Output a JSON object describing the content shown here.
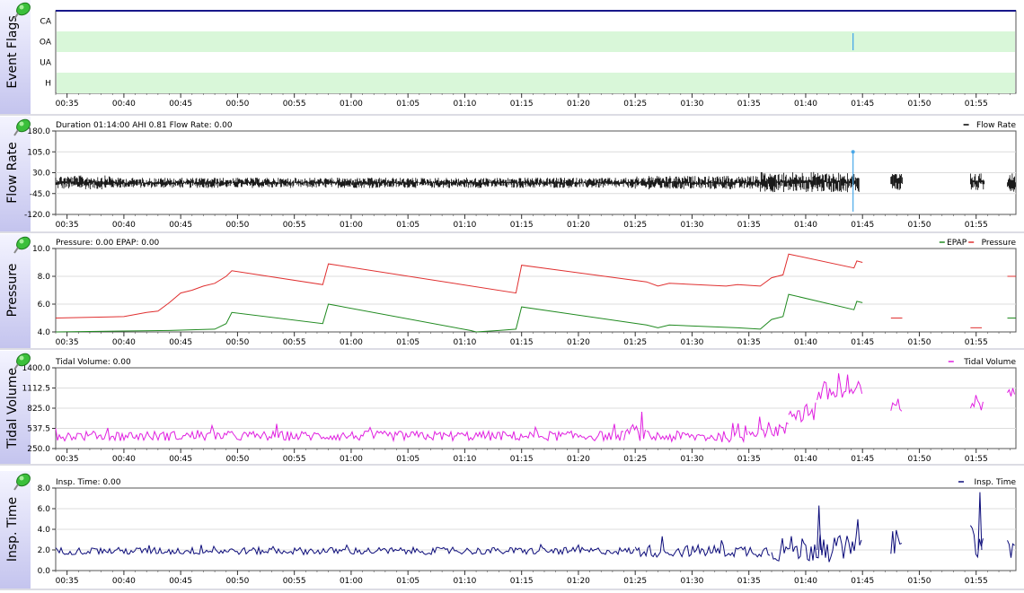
{
  "time_ticks": [
    "00:35",
    "00:40",
    "00:45",
    "00:50",
    "00:55",
    "01:00",
    "01:05",
    "01:10",
    "01:15",
    "01:20",
    "01:25",
    "01:30",
    "01:35",
    "01:40",
    "01:45",
    "01:50",
    "01:55"
  ],
  "colors": {
    "side_gradient_top": "#f4f4ff",
    "side_gradient_bottom": "#c4c4ee",
    "event_band": "#d9f7d9",
    "flow": "#000000",
    "marker": "#4aa8e8",
    "pressure": "#e03030",
    "epap": "#208a20",
    "tidal": "#e020e0",
    "insp": "#0c0c7a",
    "frame_top": "#18188a",
    "grid": "#dcdcdc"
  },
  "icons": {
    "pin": "green-pushpin-icon"
  },
  "chart_data": [
    {
      "type": "event-flags",
      "ylabel": "Event Flags",
      "categories": [
        "CA",
        "OA",
        "UA",
        "H"
      ],
      "shaded_rows": [
        "OA",
        "H"
      ],
      "events": [
        {
          "flag": "OA",
          "time": "01:44:10"
        }
      ]
    },
    {
      "type": "line",
      "ylabel": "Flow Rate",
      "info": "Duration 01:14:00 AHI 0.81 Flow Rate: 0.00",
      "legend": [
        "Flow Rate"
      ],
      "yticks": [
        "180.0",
        "105.0",
        "30.0",
        "-45.0",
        "-120.0"
      ],
      "ylim": [
        -120,
        180
      ],
      "series": [
        {
          "name": "Flow Rate",
          "color": "#000000",
          "envelope": [
            {
              "t0": "00:34:00",
              "t1": "00:39:00",
              "lo": -30,
              "hi": 20
            },
            {
              "t0": "00:39:00",
              "t1": "01:25:00",
              "lo": -25,
              "hi": 12
            },
            {
              "t0": "01:25:00",
              "t1": "01:36:00",
              "lo": -30,
              "hi": 18
            },
            {
              "t0": "01:36:00",
              "t1": "01:44:45",
              "lo": -40,
              "hi": 33
            },
            {
              "t0": "01:47:30",
              "t1": "01:48:30",
              "lo": -35,
              "hi": 28
            },
            {
              "t0": "01:54:30",
              "t1": "01:55:45",
              "lo": -35,
              "hi": 28
            },
            {
              "t0": "01:57:45",
              "t1": "01:58:30",
              "lo": -40,
              "hi": 30
            }
          ]
        }
      ],
      "marker": {
        "time": "01:44:10",
        "value": 105
      }
    },
    {
      "type": "line",
      "ylabel": "Pressure",
      "info": "Pressure: 0.00 EPAP: 0.00",
      "legend": [
        "EPAP",
        "Pressure"
      ],
      "yticks": [
        "10.0",
        "8.0",
        "6.0",
        "4.0"
      ],
      "ylim": [
        4,
        10
      ],
      "series": [
        {
          "name": "Pressure",
          "color": "#e03030",
          "points": [
            [
              "00:34:00",
              5.0
            ],
            [
              "00:40:00",
              5.1
            ],
            [
              "00:42:00",
              5.4
            ],
            [
              "00:43:00",
              5.5
            ],
            [
              "00:44:00",
              6.1
            ],
            [
              "00:45:00",
              6.8
            ],
            [
              "00:46:00",
              7.0
            ],
            [
              "00:47:00",
              7.3
            ],
            [
              "00:48:00",
              7.5
            ],
            [
              "00:49:00",
              8.0
            ],
            [
              "00:49:30",
              8.4
            ],
            [
              "00:57:30",
              7.4
            ],
            [
              "00:58:00",
              8.9
            ],
            [
              "01:14:30",
              6.8
            ],
            [
              "01:15:00",
              8.8
            ],
            [
              "01:26:00",
              7.6
            ],
            [
              "01:27:00",
              7.3
            ],
            [
              "01:28:00",
              7.5
            ],
            [
              "01:33:00",
              7.3
            ],
            [
              "01:34:00",
              7.4
            ],
            [
              "01:36:00",
              7.3
            ],
            [
              "01:37:00",
              7.9
            ],
            [
              "01:38:00",
              8.1
            ],
            [
              "01:38:30",
              9.6
            ],
            [
              "01:44:15",
              8.6
            ],
            [
              "01:44:30",
              9.1
            ],
            [
              "01:45:00",
              9.0
            ]
          ]
        },
        {
          "name": "EPAP",
          "color": "#208a20",
          "points": [
            [
              "00:34:00",
              4.0
            ],
            [
              "00:44:00",
              4.1
            ],
            [
              "00:48:00",
              4.2
            ],
            [
              "00:49:00",
              4.6
            ],
            [
              "00:49:30",
              5.4
            ],
            [
              "00:57:30",
              4.6
            ],
            [
              "00:58:00",
              6.0
            ],
            [
              "01:10:30",
              4.1
            ],
            [
              "01:11:00",
              4.0
            ],
            [
              "01:13:00",
              4.1
            ],
            [
              "01:14:30",
              4.2
            ],
            [
              "01:15:00",
              5.8
            ],
            [
              "01:26:00",
              4.5
            ],
            [
              "01:27:00",
              4.3
            ],
            [
              "01:28:00",
              4.5
            ],
            [
              "01:34:00",
              4.3
            ],
            [
              "01:36:00",
              4.2
            ],
            [
              "01:37:00",
              4.9
            ],
            [
              "01:38:00",
              5.1
            ],
            [
              "01:38:30",
              6.7
            ],
            [
              "01:44:15",
              5.6
            ],
            [
              "01:44:30",
              6.2
            ],
            [
              "01:45:00",
              6.1
            ]
          ]
        }
      ],
      "segments": [
        {
          "series": "Pressure",
          "t0": "01:47:30",
          "t1": "01:48:30",
          "value": 5.0
        },
        {
          "series": "Pressure",
          "t0": "01:54:30",
          "t1": "01:55:30",
          "value": 4.3
        },
        {
          "series": "Pressure",
          "t0": "01:57:45",
          "t1": "01:58:30",
          "value": 8.0
        },
        {
          "series": "EPAP",
          "t0": "01:57:45",
          "t1": "01:58:30",
          "value": 5.0
        }
      ]
    },
    {
      "type": "line",
      "ylabel": "Tidal Volume",
      "info": "Tidal Volume: 0.00",
      "legend": [
        "Tidal Volume"
      ],
      "yticks": [
        "1400.0",
        "1112.5",
        "825.0",
        "537.5",
        "250.0"
      ],
      "ylim": [
        250,
        1400
      ],
      "series": [
        {
          "name": "Tidal Volume",
          "color": "#e020e0",
          "runs": [
            {
              "t0": "00:34:00",
              "t1": "01:24:00",
              "base": 430,
              "noise": 70
            },
            {
              "t0": "01:24:00",
              "t1": "01:26:00",
              "base": 480,
              "noise": 120
            },
            {
              "t0": "01:26:00",
              "t1": "01:35:00",
              "base": 420,
              "noise": 80
            },
            {
              "t0": "01:35:00",
              "t1": "01:38:30",
              "base": 520,
              "noise": 110
            },
            {
              "t0": "01:38:30",
              "t1": "01:41:00",
              "base": 780,
              "noise": 180
            },
            {
              "t0": "01:41:00",
              "t1": "01:45:00",
              "base": 1050,
              "noise": 160
            },
            {
              "t0": "01:47:30",
              "t1": "01:48:30",
              "base": 820,
              "noise": 90
            },
            {
              "t0": "01:54:30",
              "t1": "01:55:45",
              "base": 900,
              "noise": 130
            },
            {
              "t0": "01:57:45",
              "t1": "01:58:30",
              "base": 1060,
              "noise": 70
            }
          ]
        }
      ]
    },
    {
      "type": "line",
      "ylabel": "Insp. Time",
      "info": "Insp. Time: 0.00",
      "legend": [
        "Insp. Time"
      ],
      "yticks": [
        "8.0",
        "6.0",
        "4.0",
        "2.0",
        "0.0"
      ],
      "ylim": [
        0,
        8
      ],
      "series": [
        {
          "name": "Insp. Time",
          "color": "#0c0c7a",
          "runs": [
            {
              "t0": "00:34:00",
              "t1": "01:25:00",
              "base": 1.9,
              "noise": 0.35
            },
            {
              "t0": "01:25:00",
              "t1": "01:37:00",
              "base": 1.9,
              "noise": 0.6
            },
            {
              "t0": "01:37:00",
              "t1": "01:45:00",
              "base": 2.1,
              "noise": 1.3
            },
            {
              "t0": "01:47:30",
              "t1": "01:48:30",
              "base": 2.8,
              "noise": 1.2
            },
            {
              "t0": "01:54:30",
              "t1": "01:55:45",
              "base": 2.8,
              "noise": 1.6
            },
            {
              "t0": "01:57:45",
              "t1": "01:58:30",
              "base": 2.2,
              "noise": 1.0
            }
          ]
        }
      ],
      "peaks": [
        [
          "01:41:10",
          6.3
        ],
        [
          "01:55:20",
          7.6
        ]
      ]
    }
  ]
}
